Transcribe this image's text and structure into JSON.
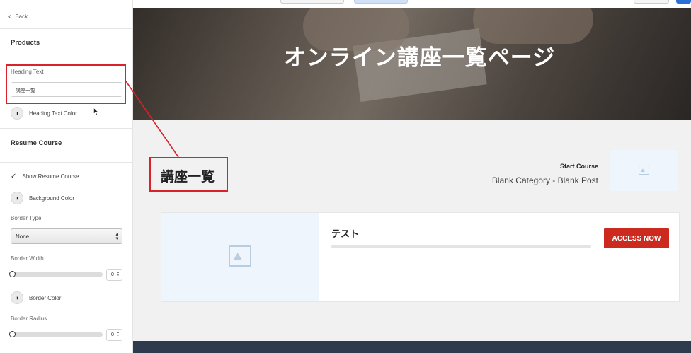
{
  "top_bar": {},
  "sidebar": {
    "back_label": "Back",
    "products_title": "Products",
    "heading_text_label": "Heading Text",
    "heading_text_value": "講座一覧",
    "heading_text_color_label": "Heading Text Color",
    "resume_course_title": "Resume Course",
    "show_resume_course_label": "Show Resume Course",
    "show_resume_course_checked": true,
    "background_color_label": "Background Color",
    "border_type_label": "Border Type",
    "border_type_value": "None",
    "border_width_label": "Border Width",
    "border_width_value": "0",
    "border_color_label": "Border Color",
    "border_radius_label": "Border Radius",
    "border_radius_value": "0"
  },
  "preview": {
    "hero_title": "オンライン講座一覧ページ",
    "heading_text": "講座一覧",
    "start_course_label": "Start Course",
    "blank_post_text": "Blank Category - Blank Post",
    "course_card": {
      "title": "テスト",
      "progress": 0,
      "button_label": "ACCESS NOW"
    }
  },
  "colors": {
    "accent_red": "#cc2a1e",
    "annotation_red": "#d8232a",
    "footer_navy": "#2e3a4e",
    "placeholder_blue": "#eef5fc"
  },
  "icons": [
    "chevron-left-icon",
    "color-picker-icon",
    "checkmark-icon",
    "image-placeholder-icon",
    "collapse-arrow-icon"
  ]
}
